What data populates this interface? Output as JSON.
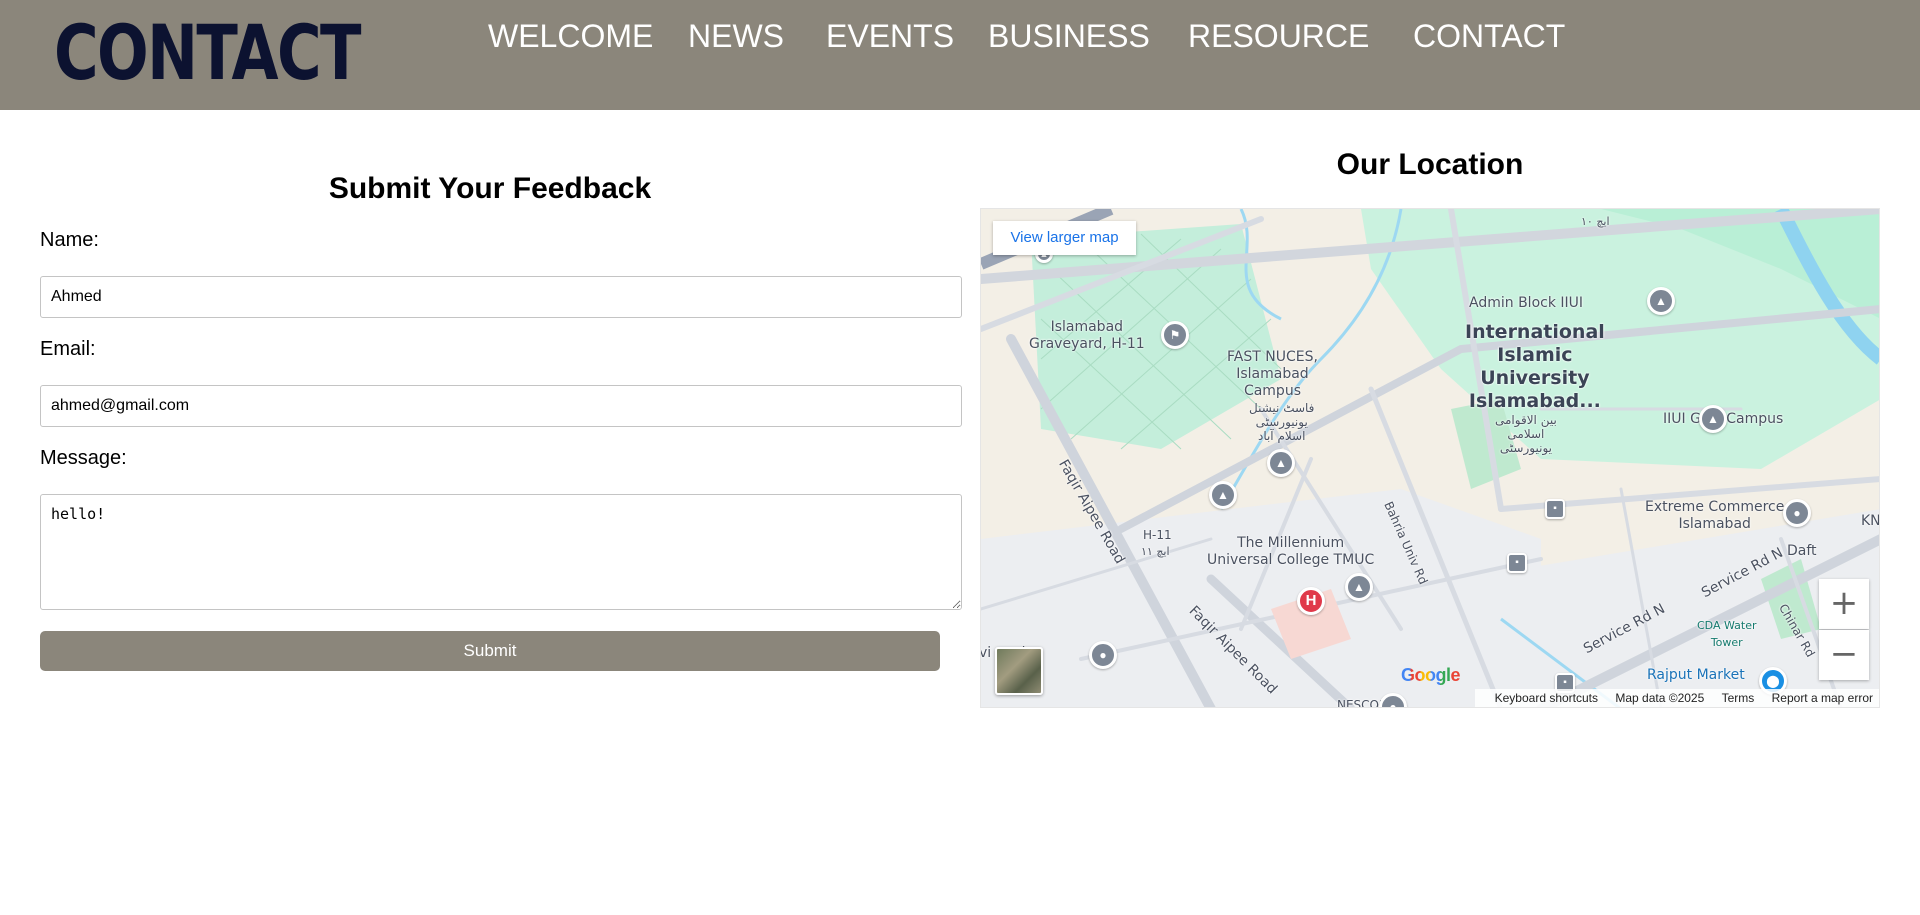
{
  "header": {
    "logo_text": "CONTACT",
    "nav": [
      "WELCOME",
      "NEWS",
      "EVENTS",
      "BUSINESS",
      "RESOURCE",
      "CONTACT"
    ]
  },
  "feedback": {
    "title": "Submit Your Feedback",
    "name_label": "Name:",
    "name_value": "Ahmed",
    "email_label": "Email:",
    "email_value": "ahmed@gmail.com",
    "message_label": "Message:",
    "message_value": "hello!",
    "submit_label": "Submit"
  },
  "location": {
    "title": "Our Location",
    "map": {
      "view_larger": "View larger map",
      "zoom_in": "+",
      "zoom_out": "−",
      "google": "Google",
      "footer": {
        "shortcuts": "Keyboard shortcuts",
        "map_data": "Map data ©2025",
        "terms": "Terms",
        "report": "Report a map error"
      },
      "labels": {
        "graveyard": "Islamabad\nGraveyard, H-11",
        "fast": "FAST NUCES,\nIslamabad\nCampus",
        "fast_urdu": "فاسٹ نیشنل\nیونیورسٹی\nاسلام آباد",
        "iiui": "International\nIslamic\nUniversity\nIslamabad...",
        "iiui_urdu": "بین الاقوامی\nاسلامی\nیونیورسٹی",
        "admin_block": "Admin Block IIUI",
        "girls_campus": "IIUI Girls Campus",
        "extreme": "Extreme Commerce\nIslamabad",
        "millennium": "The Millennium\nUniversal College TMUC",
        "faqir_road_1": "Faqir Aipee Road",
        "faqir_road_2": "Faqir Aipee Road",
        "bahria": "Bahria Univ Rd",
        "h11": "H-11",
        "h11_urdu": "ایچ ۱۱",
        "service_rd": "Service Rd N",
        "service_rd_2": "Service Rd N",
        "chinar": "Chinar Rd",
        "cda_tower": "CDA Water\nTower",
        "rajput": "Rajput Market",
        "pool": "vi pool",
        "nescom": "NESCOM",
        "daft": "Daft",
        "kn": "KN",
        "top_urdu": "ایچ ۱۰"
      }
    }
  }
}
